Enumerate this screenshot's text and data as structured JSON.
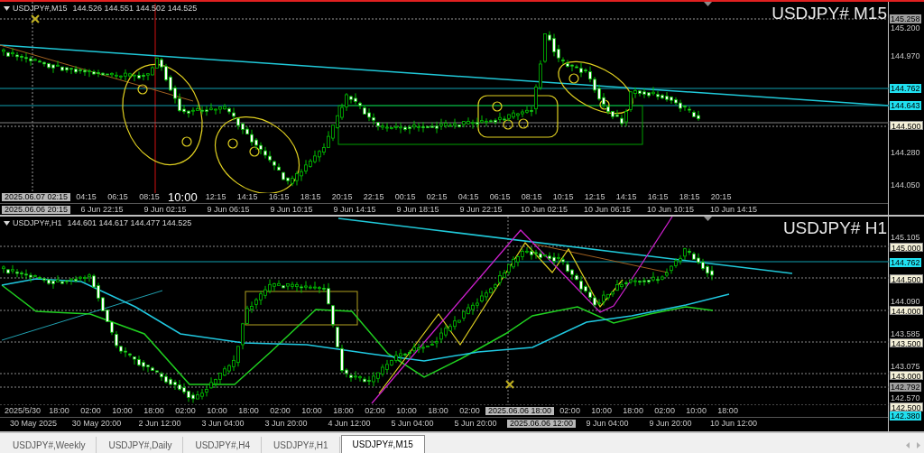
{
  "panels": [
    {
      "symbol": "USDJPY#,M15",
      "ohlc": "144.526 144.551 144.502 144.525",
      "title": "USDJPY# M15",
      "price_labels": [
        {
          "text": "145.258",
          "kind": "gray"
        },
        {
          "text": "145.200",
          "kind": "plain"
        },
        {
          "text": "144.970",
          "kind": "plain"
        },
        {
          "text": "144.762",
          "kind": "cyan"
        },
        {
          "text": "144.643",
          "kind": "cyan"
        },
        {
          "text": "144.500",
          "kind": "box"
        },
        {
          "text": "144.280",
          "kind": "plain"
        },
        {
          "text": "144.050",
          "kind": "plain"
        }
      ],
      "time_rows": [
        [
          {
            "text": "2025.06.07 02:15",
            "kind": "box"
          },
          {
            "text": "04:15",
            "kind": "plain"
          },
          {
            "text": "06:15",
            "kind": "plain"
          },
          {
            "text": "08:15",
            "kind": "plain"
          },
          {
            "text": "10:00",
            "kind": "marker"
          },
          {
            "text": "12:15",
            "kind": "plain"
          },
          {
            "text": "14:15",
            "kind": "plain"
          },
          {
            "text": "16:15",
            "kind": "plain"
          },
          {
            "text": "18:15",
            "kind": "plain"
          },
          {
            "text": "20:15",
            "kind": "plain"
          },
          {
            "text": "22:15",
            "kind": "plain"
          },
          {
            "text": "00:15",
            "kind": "plain"
          },
          {
            "text": "02:15",
            "kind": "plain"
          },
          {
            "text": "04:15",
            "kind": "plain"
          },
          {
            "text": "06:15",
            "kind": "plain"
          },
          {
            "text": "08:15",
            "kind": "plain"
          },
          {
            "text": "10:15",
            "kind": "plain"
          },
          {
            "text": "12:15",
            "kind": "plain"
          },
          {
            "text": "14:15",
            "kind": "plain"
          },
          {
            "text": "16:15",
            "kind": "plain"
          },
          {
            "text": "18:15",
            "kind": "plain"
          },
          {
            "text": "20:15",
            "kind": "plain"
          }
        ],
        [
          {
            "text": "2025.06.06 20:15",
            "kind": "box"
          },
          {
            "text": "6 Jun 22:15",
            "kind": "plain"
          },
          {
            "text": "9 Jun 02:15",
            "kind": "plain"
          },
          {
            "text": "9 Jun 06:15",
            "kind": "plain"
          },
          {
            "text": "9 Jun 10:15",
            "kind": "plain"
          },
          {
            "text": "9 Jun 14:15",
            "kind": "plain"
          },
          {
            "text": "9 Jun 18:15",
            "kind": "plain"
          },
          {
            "text": "9 Jun 22:15",
            "kind": "plain"
          },
          {
            "text": "10 Jun 02:15",
            "kind": "plain"
          },
          {
            "text": "10 Jun 06:15",
            "kind": "plain"
          },
          {
            "text": "10 Jun 10:15",
            "kind": "plain"
          },
          {
            "text": "10 Jun 14:15",
            "kind": "plain"
          }
        ]
      ]
    },
    {
      "symbol": "USDJPY#,H1",
      "ohlc": "144.601 144.617 144.477 144.525",
      "title": "USDJPY# H1",
      "price_labels": [
        {
          "text": "145.105",
          "kind": "plain"
        },
        {
          "text": "145.000",
          "kind": "box"
        },
        {
          "text": "144.762",
          "kind": "cyan"
        },
        {
          "text": "144.500",
          "kind": "box"
        },
        {
          "text": "144.090",
          "kind": "plain"
        },
        {
          "text": "144.000",
          "kind": "box"
        },
        {
          "text": "143.585",
          "kind": "plain"
        },
        {
          "text": "143.500",
          "kind": "box"
        },
        {
          "text": "143.075",
          "kind": "plain"
        },
        {
          "text": "143.000",
          "kind": "box"
        },
        {
          "text": "142.792",
          "kind": "gray"
        },
        {
          "text": "142.570",
          "kind": "plain"
        },
        {
          "text": "142.500",
          "kind": "box"
        },
        {
          "text": "142.380",
          "kind": "cyan"
        }
      ],
      "time_rows": [
        [
          {
            "text": "2025/5/30",
            "kind": "plain"
          },
          {
            "text": "18:00",
            "kind": "plain"
          },
          {
            "text": "02:00",
            "kind": "plain"
          },
          {
            "text": "10:00",
            "kind": "plain"
          },
          {
            "text": "18:00",
            "kind": "plain"
          },
          {
            "text": "02:00",
            "kind": "plain"
          },
          {
            "text": "10:00",
            "kind": "plain"
          },
          {
            "text": "18:00",
            "kind": "plain"
          },
          {
            "text": "02:00",
            "kind": "plain"
          },
          {
            "text": "10:00",
            "kind": "plain"
          },
          {
            "text": "18:00",
            "kind": "plain"
          },
          {
            "text": "02:00",
            "kind": "plain"
          },
          {
            "text": "10:00",
            "kind": "plain"
          },
          {
            "text": "18:00",
            "kind": "plain"
          },
          {
            "text": "02:00",
            "kind": "plain"
          },
          {
            "text": "2025.06.06 18:00",
            "kind": "box"
          },
          {
            "text": "02:00",
            "kind": "plain"
          },
          {
            "text": "10:00",
            "kind": "plain"
          },
          {
            "text": "18:00",
            "kind": "plain"
          },
          {
            "text": "02:00",
            "kind": "plain"
          },
          {
            "text": "10:00",
            "kind": "plain"
          },
          {
            "text": "18:00",
            "kind": "plain"
          }
        ],
        [
          {
            "text": "30 May 2025",
            "kind": "plain"
          },
          {
            "text": "30 May 20:00",
            "kind": "plain"
          },
          {
            "text": "2 Jun 12:00",
            "kind": "plain"
          },
          {
            "text": "3 Jun 04:00",
            "kind": "plain"
          },
          {
            "text": "3 Jun 20:00",
            "kind": "plain"
          },
          {
            "text": "4 Jun 12:00",
            "kind": "plain"
          },
          {
            "text": "5 Jun 04:00",
            "kind": "plain"
          },
          {
            "text": "5 Jun 20:00",
            "kind": "plain"
          },
          {
            "text": "2025.06.06 12:00",
            "kind": "box"
          },
          {
            "text": "9 Jun 04:00",
            "kind": "plain"
          },
          {
            "text": "9 Jun 20:00",
            "kind": "plain"
          },
          {
            "text": "10 Jun 12:00",
            "kind": "plain"
          }
        ]
      ]
    }
  ],
  "tabs": [
    {
      "label": "USDJPY#,Weekly",
      "selected": false
    },
    {
      "label": "USDJPY#,Daily",
      "selected": false
    },
    {
      "label": "USDJPY#,H4",
      "selected": false
    },
    {
      "label": "USDJPY#,H1",
      "selected": false
    },
    {
      "label": "USDJPY#,M15",
      "selected": true
    }
  ]
}
